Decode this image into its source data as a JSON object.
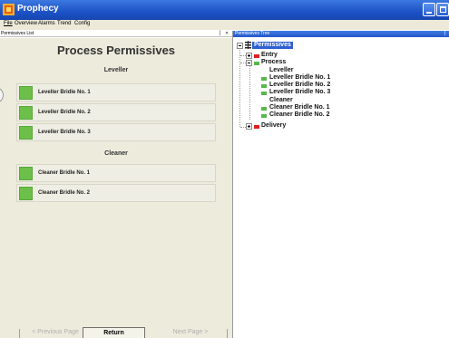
{
  "window": {
    "title": "Prophecy"
  },
  "menu": [
    {
      "label": "File"
    },
    {
      "label": "Overview"
    },
    {
      "label": "Alarms"
    },
    {
      "label": "Trend"
    },
    {
      "label": "Config"
    }
  ],
  "left_pane": {
    "header": "Permissives List",
    "pin_glyph": "▕",
    "close_glyph": "✕",
    "title": "Process Permissives",
    "groups": [
      {
        "title": "Leveller",
        "items": [
          {
            "label": "Leveller Bridle No. 1",
            "status_color": "#6cc04a"
          },
          {
            "label": "Leveller Bridle No. 2",
            "status_color": "#6cc04a"
          },
          {
            "label": "Leveller Bridle No. 3",
            "status_color": "#6cc04a"
          }
        ]
      },
      {
        "title": "Cleaner",
        "items": [
          {
            "label": "Cleaner Bridle No. 1",
            "status_color": "#6cc04a"
          },
          {
            "label": "Cleaner Bridle No. 2",
            "status_color": "#6cc04a"
          }
        ]
      }
    ],
    "nav": {
      "prev": "< Previous Page",
      "return": "Return",
      "next": "Next Page >"
    }
  },
  "right_pane": {
    "header": "Permissives Tree",
    "pin_glyph": "▕",
    "tree": {
      "root": "Permissives",
      "nodes": [
        {
          "label": "Entry",
          "status_color": "#e02020"
        },
        {
          "label": "Process",
          "status_color": "#58b84a"
        },
        {
          "label": "Leveller"
        },
        {
          "label": "Leveller Bridle No. 1",
          "status_color": "#58b84a"
        },
        {
          "label": "Leveller Bridle No. 2",
          "status_color": "#58b84a"
        },
        {
          "label": "Leveller Bridle No. 3",
          "status_color": "#58b84a"
        },
        {
          "label": "Cleaner"
        },
        {
          "label": "Cleaner Bridle No. 1",
          "status_color": "#58b84a"
        },
        {
          "label": "Cleaner Bridle No. 2",
          "status_color": "#58b84a"
        },
        {
          "label": "Delivery",
          "status_color": "#e02020"
        }
      ]
    }
  },
  "colors": {
    "ok": "#6cc04a",
    "fault": "#e02020",
    "selection": "#2f5fd0"
  }
}
